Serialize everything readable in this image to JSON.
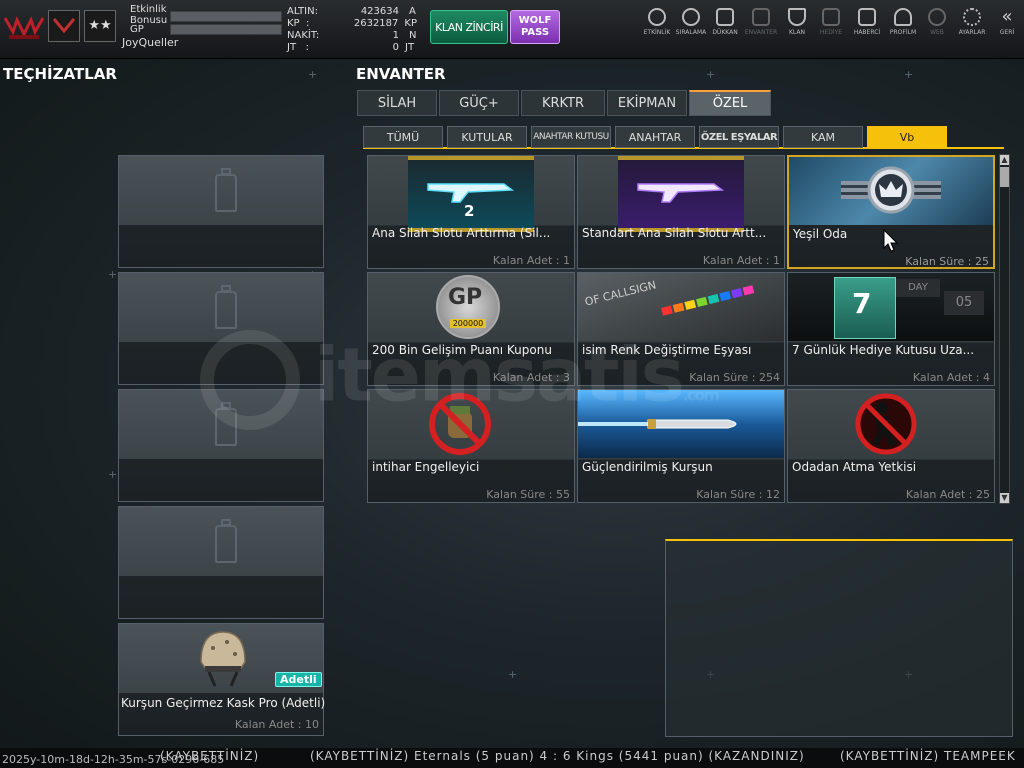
{
  "player": {
    "event_bonus_label": "Etkinlik\nBonusu",
    "gp_label": "GP",
    "username": "JoyQueller",
    "currencies": [
      {
        "label": "ALTIN:",
        "value": "423634",
        "unit": "A"
      },
      {
        "label": "KP  :",
        "value": "2632187",
        "unit": "KP"
      },
      {
        "label": "NAKİT:",
        "value": "1",
        "unit": "N"
      },
      {
        "label": "JT   :",
        "value": "0",
        "unit": "JT"
      }
    ]
  },
  "buttons": {
    "klan_chain": "KLAN ZİNCİRİ",
    "wolf_pass": "WOLF\nPASS"
  },
  "nav": [
    {
      "label": "ETKİNLİK",
      "icon": "stopwatch-icon"
    },
    {
      "label": "SIRALAMA",
      "icon": "medal-icon"
    },
    {
      "label": "DÜKKAN",
      "icon": "cart-icon"
    },
    {
      "label": "ENVANTER",
      "icon": "inventory-icon"
    },
    {
      "label": "KLAN",
      "icon": "shield-icon"
    },
    {
      "label": "HEDİYE",
      "icon": "gift-icon"
    },
    {
      "label": "HABERCİ",
      "icon": "megaphone-icon"
    },
    {
      "label": "PROFİLM",
      "icon": "profile-icon"
    },
    {
      "label": "WEB",
      "icon": "globe-icon"
    },
    {
      "label": "AYARLAR",
      "icon": "gear-icon"
    },
    {
      "label": "GERİ",
      "icon": "back-chevron-icon"
    }
  ],
  "equipment": {
    "title": "TEÇHİZATLAR",
    "helmet": {
      "badge": "Adetli",
      "name": "Kurşun Geçirmez Kask Pro (Adetli)",
      "count": "Kalan Adet : 10"
    }
  },
  "inventory": {
    "title": "ENVANTER",
    "tabs": [
      "SİLAH",
      "GÜÇ+",
      "KRKTR",
      "EKİPMAN",
      "ÖZEL"
    ],
    "subtabs": [
      "TÜMÜ",
      "KUTULAR",
      "ANAHTAR KUTUSU",
      "ANAHTAR",
      "ÖZEL EŞYALAR",
      "KAM",
      "Vb"
    ],
    "items": [
      {
        "name": "Ana Silah Slotu Arttırma (Sil...",
        "count": "Kalan Adet : 1",
        "thumb_text": "2"
      },
      {
        "name": "Standart Ana Silah Slotu Artt...",
        "count": "Kalan Adet : 1",
        "thumb_text": ""
      },
      {
        "name": "Yeşil Oda",
        "count": "Kalan Süre : 25",
        "thumb_text": ""
      },
      {
        "name": "200 Bin Gelişim Puanı Kuponu",
        "count": "Kalan Adet : 3",
        "thumb_text": "200000"
      },
      {
        "name": "isim Renk Değiştirme Eşyası",
        "count": "Kalan Süre : 254",
        "thumb_text": "OF CALLSIGN"
      },
      {
        "name": "7 Günlük Hediye Kutusu Uza...",
        "count": "Kalan Adet : 4",
        "thumb_text": "7"
      },
      {
        "name": "intihar Engelleyici",
        "count": "Kalan Süre : 55",
        "thumb_text": ""
      },
      {
        "name": "Güçlendirilmiş Kurşun",
        "count": "Kalan Süre : 12",
        "thumb_text": ""
      },
      {
        "name": "Odadan Atma Yetkisi",
        "count": "Kalan Adet : 25",
        "thumb_text": ""
      }
    ]
  },
  "watermark": "itemsatis",
  "watermark_com": ".com",
  "bottom": {
    "timer": "2025y-10m-18d-12h-35m-57s-0296-685",
    "ticker1": "(KAYBETTİNİZ)",
    "ticker2": "(KAYBETTİNİZ) Eternals (5 puan) 4 : 6 Kings (5441 puan) (KAZANDINIZ)",
    "ticker3": "(KAYBETTİNİZ) TEAMPEEK"
  }
}
